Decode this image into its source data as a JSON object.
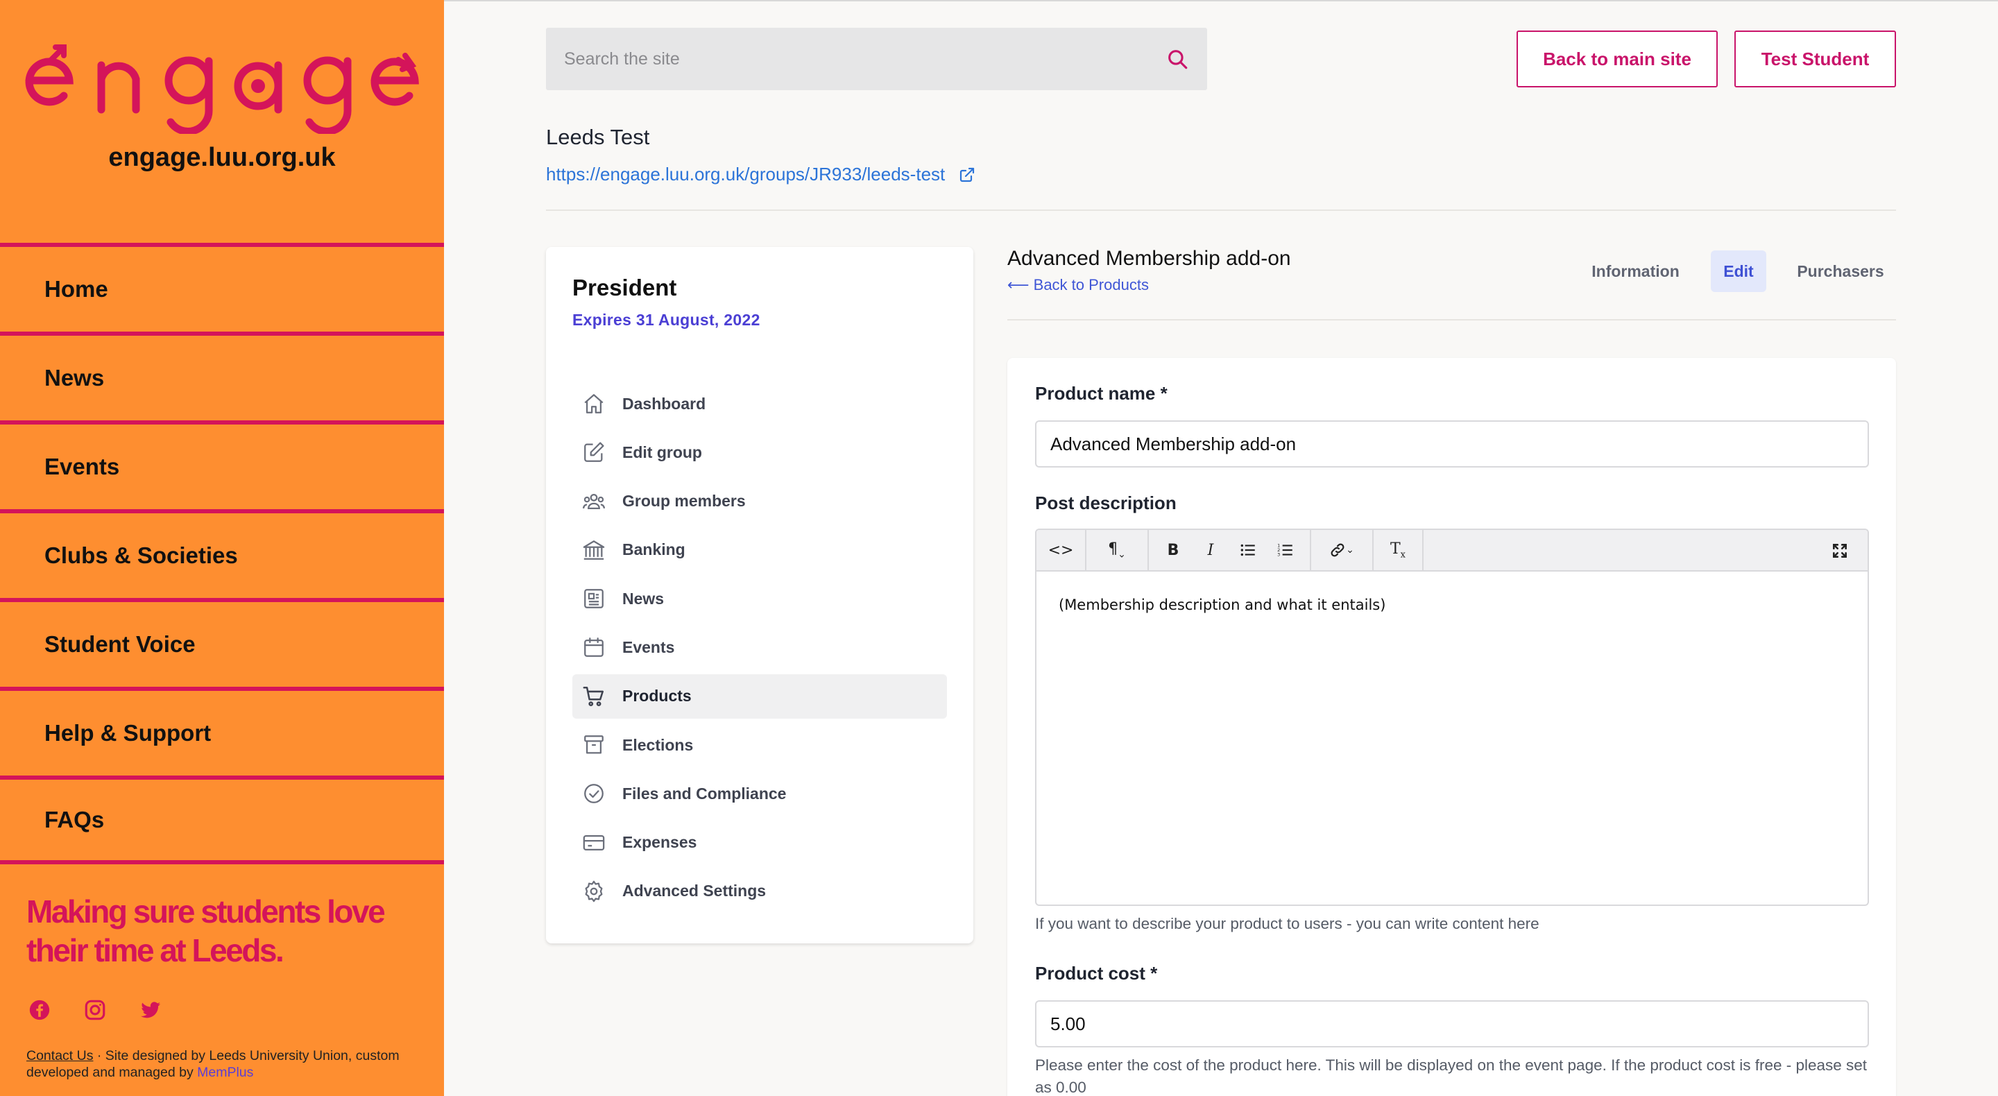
{
  "sidebar": {
    "logo_text": "engage",
    "domain": "engage.luu.org.uk",
    "nav": [
      {
        "label": "Home"
      },
      {
        "label": "News"
      },
      {
        "label": "Events"
      },
      {
        "label": "Clubs & Societies"
      },
      {
        "label": "Student Voice"
      },
      {
        "label": "Help & Support"
      },
      {
        "label": "FAQs"
      }
    ],
    "tagline": "Making sure students love their time at Leeds.",
    "social": [
      "facebook-icon",
      "instagram-icon",
      "twitter-icon"
    ],
    "footer": {
      "contact": "Contact Us",
      "text": " · Site designed by Leeds University Union, custom developed and managed by ",
      "memplus": "MemPlus"
    }
  },
  "header": {
    "search_placeholder": "Search the site",
    "back_button": "Back to main site",
    "user_button": "Test Student"
  },
  "group": {
    "title": "Leeds Test",
    "url": "https://engage.luu.org.uk/groups/JR933/leeds-test"
  },
  "role_card": {
    "role": "President",
    "expires": "Expires 31 August, 2022",
    "menu": [
      {
        "label": "Dashboard",
        "icon": "home-icon"
      },
      {
        "label": "Edit group",
        "icon": "edit-icon"
      },
      {
        "label": "Group members",
        "icon": "users-icon"
      },
      {
        "label": "Banking",
        "icon": "bank-icon"
      },
      {
        "label": "News",
        "icon": "newspaper-icon"
      },
      {
        "label": "Events",
        "icon": "calendar-icon"
      },
      {
        "label": "Products",
        "icon": "cart-icon",
        "active": true
      },
      {
        "label": "Elections",
        "icon": "archive-icon"
      },
      {
        "label": "Files and Compliance",
        "icon": "check-circle-icon"
      },
      {
        "label": "Expenses",
        "icon": "credit-card-icon"
      },
      {
        "label": "Advanced Settings",
        "icon": "gear-icon"
      }
    ]
  },
  "product": {
    "title": "Advanced Membership add-on",
    "back_link": "⟵ Back to Products",
    "tabs": [
      {
        "label": "Information"
      },
      {
        "label": "Edit",
        "active": true
      },
      {
        "label": "Purchasers"
      }
    ]
  },
  "form": {
    "name_label": "Product name *",
    "name_value": "Advanced Membership add-on",
    "description_label": "Post description",
    "description_value": "(Membership description and what it entails)",
    "description_help": "If you want to describe your product to users - you can write content here",
    "cost_label": "Product cost *",
    "cost_value": "5.00",
    "cost_help": "Please enter the cost of the product here. This will be displayed on the event page. If the product cost is free - please set as 0.00"
  },
  "colors": {
    "sidebar_bg": "#fe8e30",
    "accent_pink": "#d4145a",
    "link_blue": "#2c74d8",
    "active_tab_bg": "#e3e8fb"
  }
}
